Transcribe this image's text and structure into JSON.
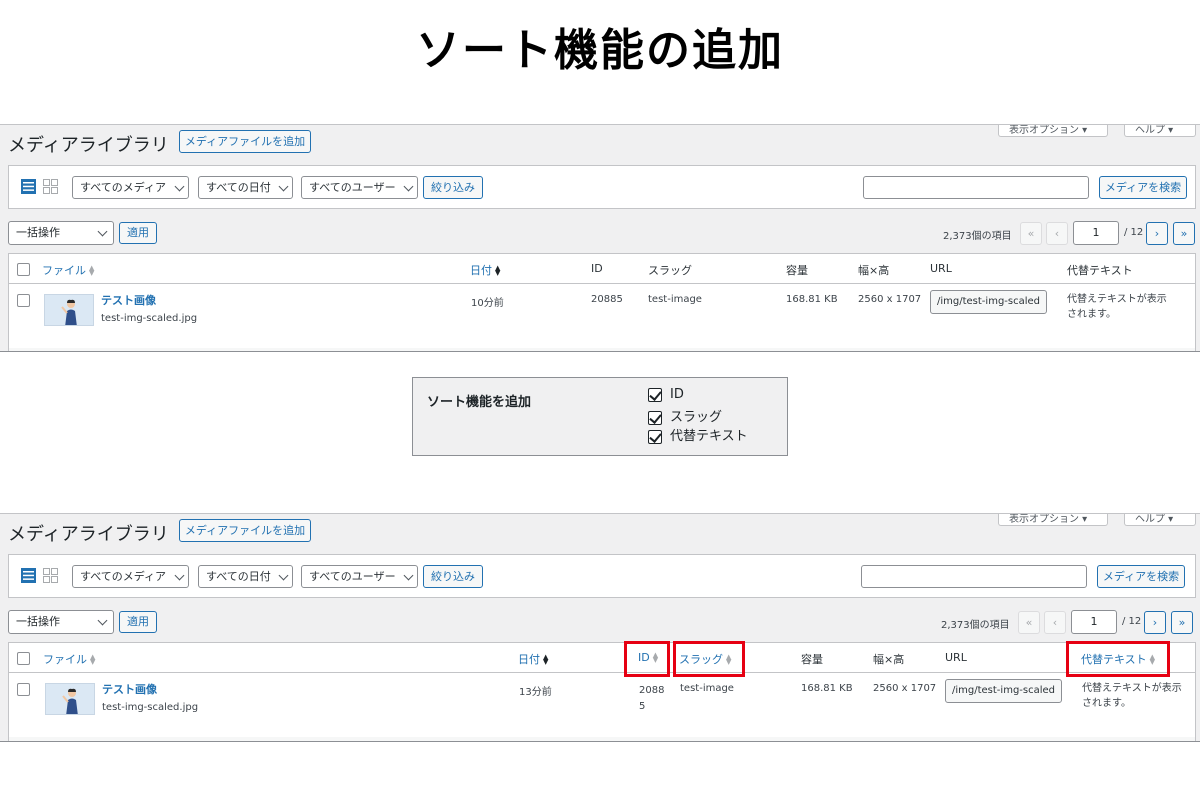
{
  "heading": "ソート機能の追加",
  "library": {
    "title": "メディアライブラリ",
    "add_button": "メディアファイルを追加",
    "screen_options": "表示オプション ▾",
    "help": "ヘルプ ▾",
    "filters": {
      "media_type": "すべてのメディア",
      "date": "すべての日付",
      "user": "すべてのユーザー",
      "filter_button": "絞り込み"
    },
    "search_button": "メディアを検索",
    "bulk_action": "一括操作",
    "apply_button": "適用",
    "item_count": "2,373個の項目",
    "pagination": {
      "first": "«",
      "prev": "‹",
      "current_page": "1",
      "total": "/ 12",
      "next": "›",
      "last": "»"
    },
    "columns": {
      "file": "ファイル",
      "date": "日付",
      "id": "ID",
      "slug": "スラッグ",
      "size": "容量",
      "dimensions": "幅×高",
      "url": "URL",
      "alt": "代替テキスト"
    }
  },
  "before": {
    "row": {
      "title": "テスト画像",
      "filename": "test-img-scaled.jpg",
      "date": "10分前",
      "id": "20885",
      "slug": "test-image",
      "size": "168.81 KB",
      "dimensions": "2560 x 1707",
      "url": "/img/test-img-scaled",
      "alt_line1": "代替えテキストが表示",
      "alt_line2": "されます。"
    }
  },
  "settings": {
    "label": "ソート機能を追加",
    "options": [
      "ID",
      "スラッグ",
      "代替テキスト"
    ]
  },
  "after": {
    "row": {
      "title": "テスト画像",
      "filename": "test-img-scaled.jpg",
      "date": "13分前",
      "id_line1": "2088",
      "id_line2": "5",
      "slug": "test-image",
      "size": "168.81 KB",
      "dimensions": "2560 x 1707",
      "url": "/img/test-img-scaled",
      "alt_line1": "代替えテキストが表示",
      "alt_line2": "されます。"
    }
  },
  "colors": {
    "link": "#2271b1",
    "highlight": "#e60012",
    "panel_bg": "#f0f0f1"
  }
}
